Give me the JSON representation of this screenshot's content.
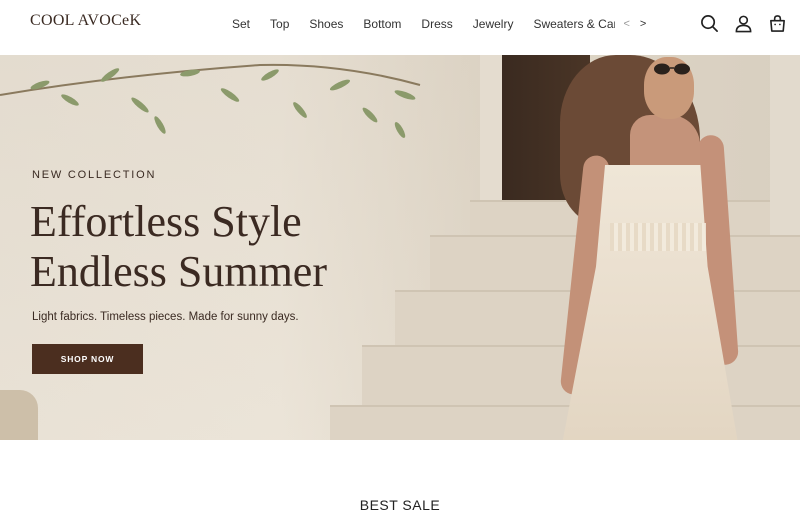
{
  "brand": {
    "logo_text": "COOL AVOCeK"
  },
  "nav": {
    "items": [
      {
        "label": "Set"
      },
      {
        "label": "Top"
      },
      {
        "label": "Shoes"
      },
      {
        "label": "Bottom"
      },
      {
        "label": "Dress"
      },
      {
        "label": "Jewelry"
      },
      {
        "label": "Sweaters & Cardi"
      }
    ],
    "prev_arrow": "<",
    "next_arrow": ">"
  },
  "header_icons": [
    "search-icon",
    "user-icon",
    "cart-icon"
  ],
  "hero": {
    "eyebrow": "NEW COLLECTION",
    "headline_line1": "Effortless Style",
    "headline_line2": "Endless Summer",
    "subline": "Light fabrics. Timeless pieces. Made for sunny days.",
    "cta_label": "SHOP NOW"
  },
  "sections": {
    "best_sale_title": "BEST SALE"
  },
  "colors": {
    "brand_brown": "#4b2e1f",
    "text_dark": "#3b2a22",
    "hero_bg": "#e9e2d6"
  }
}
